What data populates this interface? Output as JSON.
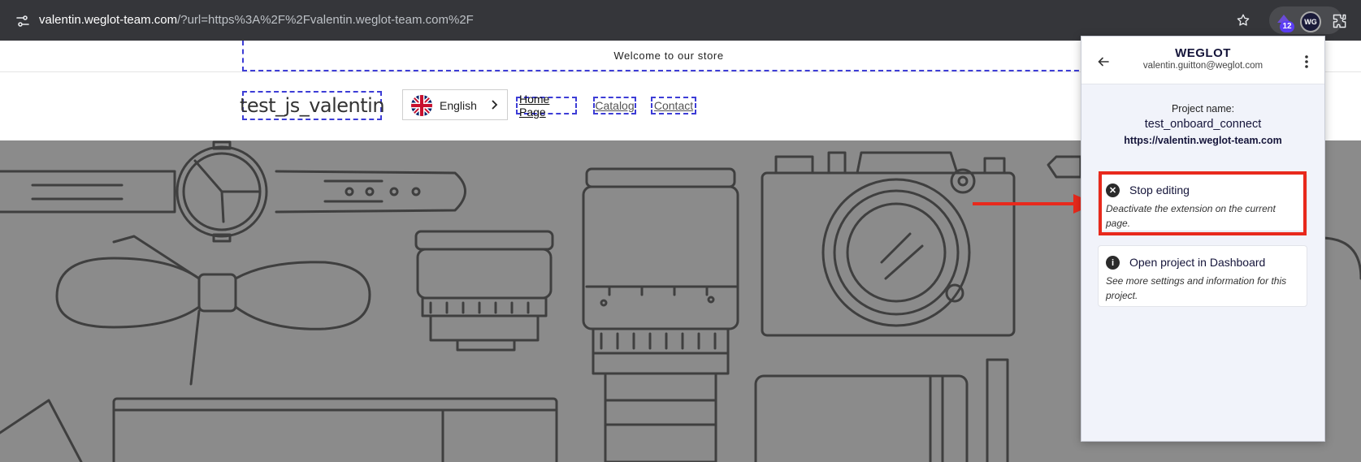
{
  "browser": {
    "url_host": "valentin.weglot-team.com",
    "url_rest": "/?url=https%3A%2F%2Fvalentin.weglot-team.com%2F",
    "extension_badge": "12",
    "extension_wg_label": "WG"
  },
  "store": {
    "announcement": "Welcome to our store",
    "title": "test_js_valentin",
    "language": "English",
    "nav": [
      "Home Page",
      "Catalog",
      "Contact"
    ]
  },
  "popup": {
    "brand": "WEGLOT",
    "account_email": "valentin.guitton@weglot.com",
    "project_name_label": "Project name:",
    "project_name": "test_onboard_connect",
    "project_url": "https://valentin.weglot-team.com",
    "actions": [
      {
        "title": "Stop editing",
        "description": "Deactivate the extension on the current page.",
        "icon": "close-circle-icon"
      },
      {
        "title": "Open project in Dashboard",
        "description": "See more settings and information for this project.",
        "icon": "info-icon"
      }
    ]
  },
  "colors": {
    "highlight": "#e8291c",
    "dashed_outline": "#3d3dd6",
    "hero_background": "#8b8b8b",
    "weglot_navy": "#15153a"
  }
}
